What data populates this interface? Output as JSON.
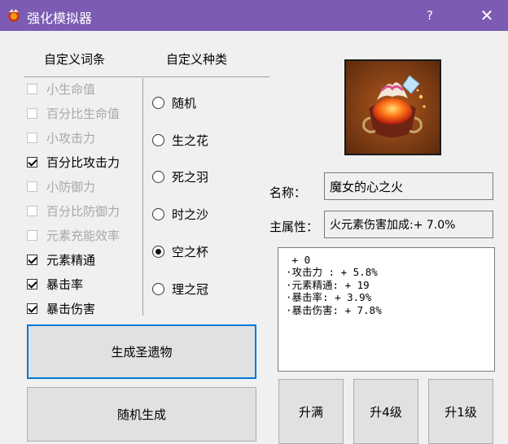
{
  "window": {
    "title": "强化模拟器",
    "help_label": "?",
    "close_label": "✕",
    "icon": "artifact-app-icon"
  },
  "headers": {
    "custom_affix": "自定义词条",
    "custom_type": "自定义种类"
  },
  "affixes": [
    {
      "label": "小生命值",
      "checked": false,
      "enabled": false
    },
    {
      "label": "百分比生命值",
      "checked": false,
      "enabled": false
    },
    {
      "label": "小攻击力",
      "checked": false,
      "enabled": false
    },
    {
      "label": "百分比攻击力",
      "checked": true,
      "enabled": true
    },
    {
      "label": "小防御力",
      "checked": false,
      "enabled": false
    },
    {
      "label": "百分比防御力",
      "checked": false,
      "enabled": false
    },
    {
      "label": "元素充能效率",
      "checked": false,
      "enabled": false
    },
    {
      "label": "元素精通",
      "checked": true,
      "enabled": true
    },
    {
      "label": "暴击率",
      "checked": true,
      "enabled": true
    },
    {
      "label": "暴击伤害",
      "checked": true,
      "enabled": true
    }
  ],
  "types": [
    {
      "label": "随机",
      "selected": false
    },
    {
      "label": "生之花",
      "selected": false
    },
    {
      "label": "死之羽",
      "selected": false
    },
    {
      "label": "时之沙",
      "selected": false
    },
    {
      "label": "空之杯",
      "selected": true
    },
    {
      "label": "理之冠",
      "selected": false
    }
  ],
  "buttons": {
    "generate": "生成圣遗物",
    "random": "随机生成",
    "max": "升满",
    "up4": "升4级",
    "up1": "升1级"
  },
  "artifact": {
    "name_label": "名称：",
    "name": "魔女的心之火",
    "main_label": "主属性：",
    "main_stat": "火元素伤害加成:+ 7.0%",
    "level": " + 0",
    "substats": [
      "·攻击力 : + 5.8%",
      "·元素精通: + 19",
      "·暴击率: + 3.9%",
      "·暴击伤害: + 7.8%"
    ]
  },
  "colors": {
    "titlebar": "#7b5bb3",
    "focus_border": "#0078d7"
  }
}
